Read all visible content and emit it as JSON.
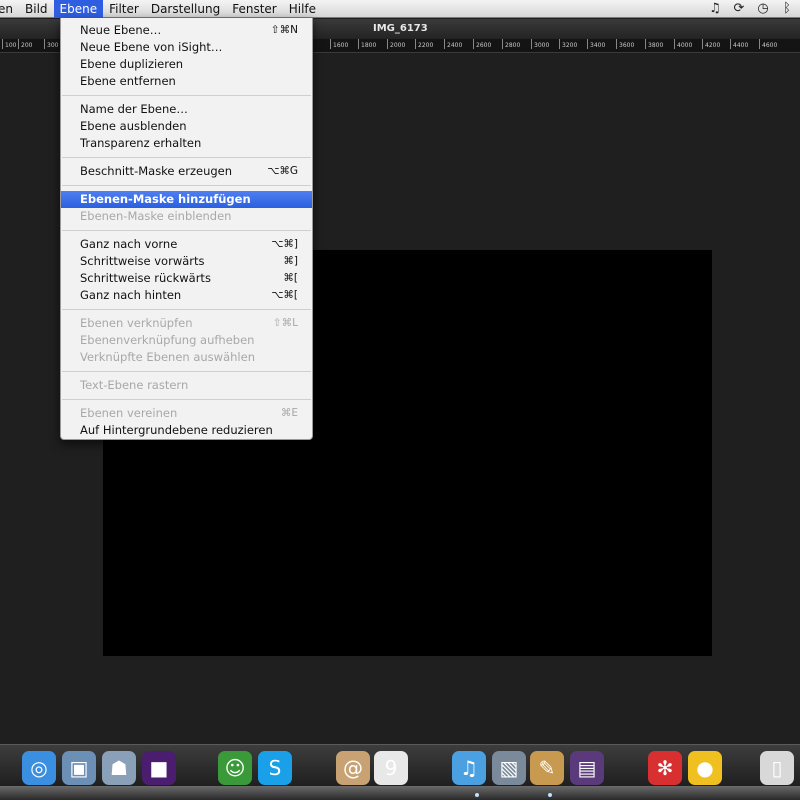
{
  "menubar": {
    "items": [
      {
        "label": "en",
        "active": false
      },
      {
        "label": "Bild",
        "active": false
      },
      {
        "label": "Ebene",
        "active": true
      },
      {
        "label": "Filter",
        "active": false
      },
      {
        "label": "Darstellung",
        "active": false
      },
      {
        "label": "Fenster",
        "active": false
      },
      {
        "label": "Hilfe",
        "active": false
      }
    ],
    "status_icons": [
      "music-note-icon",
      "sync-icon",
      "time-machine-icon",
      "bluetooth-icon"
    ]
  },
  "window": {
    "title": "IMG_6173"
  },
  "ruler": {
    "ticks": [
      "100",
      "200",
      "300",
      "1600",
      "1800",
      "2000",
      "2200",
      "2400",
      "2600",
      "2800",
      "3000",
      "3200",
      "3400",
      "3600",
      "3800",
      "4000",
      "4200",
      "4400",
      "4600"
    ]
  },
  "dropdown": {
    "groups": [
      [
        {
          "label": "Neue Ebene…",
          "shortcut": "⇧⌘N",
          "enabled": true
        },
        {
          "label": "Neue Ebene von iSight…",
          "shortcut": "",
          "enabled": true
        },
        {
          "label": "Ebene duplizieren",
          "shortcut": "",
          "enabled": true
        },
        {
          "label": "Ebene entfernen",
          "shortcut": "",
          "enabled": true
        }
      ],
      [
        {
          "label": "Name der Ebene…",
          "shortcut": "",
          "enabled": true
        },
        {
          "label": "Ebene ausblenden",
          "shortcut": "",
          "enabled": true
        },
        {
          "label": "Transparenz erhalten",
          "shortcut": "",
          "enabled": true
        }
      ],
      [
        {
          "label": "Beschnitt-Maske erzeugen",
          "shortcut": "⌥⌘G",
          "enabled": true
        }
      ],
      [
        {
          "label": "Ebenen-Maske hinzufügen",
          "shortcut": "",
          "enabled": true,
          "highlight": true
        },
        {
          "label": "Ebenen-Maske einblenden",
          "shortcut": "",
          "enabled": false
        }
      ],
      [
        {
          "label": "Ganz nach vorne",
          "shortcut": "⌥⌘]",
          "enabled": true
        },
        {
          "label": "Schrittweise vorwärts",
          "shortcut": "⌘]",
          "enabled": true
        },
        {
          "label": "Schrittweise rückwärts",
          "shortcut": "⌘[",
          "enabled": true
        },
        {
          "label": "Ganz nach hinten",
          "shortcut": "⌥⌘[",
          "enabled": true
        }
      ],
      [
        {
          "label": "Ebenen verknüpfen",
          "shortcut": "⇧⌘L",
          "enabled": false
        },
        {
          "label": "Ebenenverknüpfung aufheben",
          "shortcut": "",
          "enabled": false
        },
        {
          "label": "Verknüpfte Ebenen auswählen",
          "shortcut": "",
          "enabled": false
        }
      ],
      [
        {
          "label": "Text-Ebene rastern",
          "shortcut": "",
          "enabled": false
        }
      ],
      [
        {
          "label": "Ebenen vereinen",
          "shortcut": "⌘E",
          "enabled": false
        },
        {
          "label": "Auf Hintergrundebene reduzieren",
          "shortcut": "",
          "enabled": true
        }
      ]
    ]
  },
  "dock": {
    "icons": [
      {
        "name": "safari-icon",
        "glyph": "◎",
        "color": "#3b8fe0"
      },
      {
        "name": "preview-icon",
        "glyph": "▣",
        "color": "#6b8fb5"
      },
      {
        "name": "directory-utility-icon",
        "glyph": "☗",
        "color": "#8a9fb8"
      },
      {
        "name": "purple-app-icon",
        "glyph": "■",
        "color": "#4a1d6e"
      },
      {
        "name": "android-figure-icon",
        "glyph": "☺",
        "color": "#3a9a3a"
      },
      {
        "name": "skype-icon",
        "glyph": "S",
        "color": "#1aa0e8"
      },
      {
        "name": "address-book-icon",
        "glyph": "@",
        "color": "#c8a272"
      },
      {
        "name": "calendar-icon",
        "glyph": "9",
        "color": "#e8e8e8"
      },
      {
        "name": "itunes-icon",
        "glyph": "♫",
        "color": "#4aa0e0"
      },
      {
        "name": "iphoto-icon",
        "glyph": "▧",
        "color": "#7a8a9a"
      },
      {
        "name": "pixelmator-icon",
        "glyph": "✎",
        "color": "#c89a50"
      },
      {
        "name": "dark-app-icon",
        "glyph": "▤",
        "color": "#5a3a7a"
      },
      {
        "name": "red-ladybug-icon",
        "glyph": "✻",
        "color": "#d83030"
      },
      {
        "name": "cyberduck-icon",
        "glyph": "●",
        "color": "#f0c020"
      },
      {
        "name": "documents-stack-icon",
        "glyph": "▯",
        "color": "#d8d8d8"
      }
    ]
  }
}
